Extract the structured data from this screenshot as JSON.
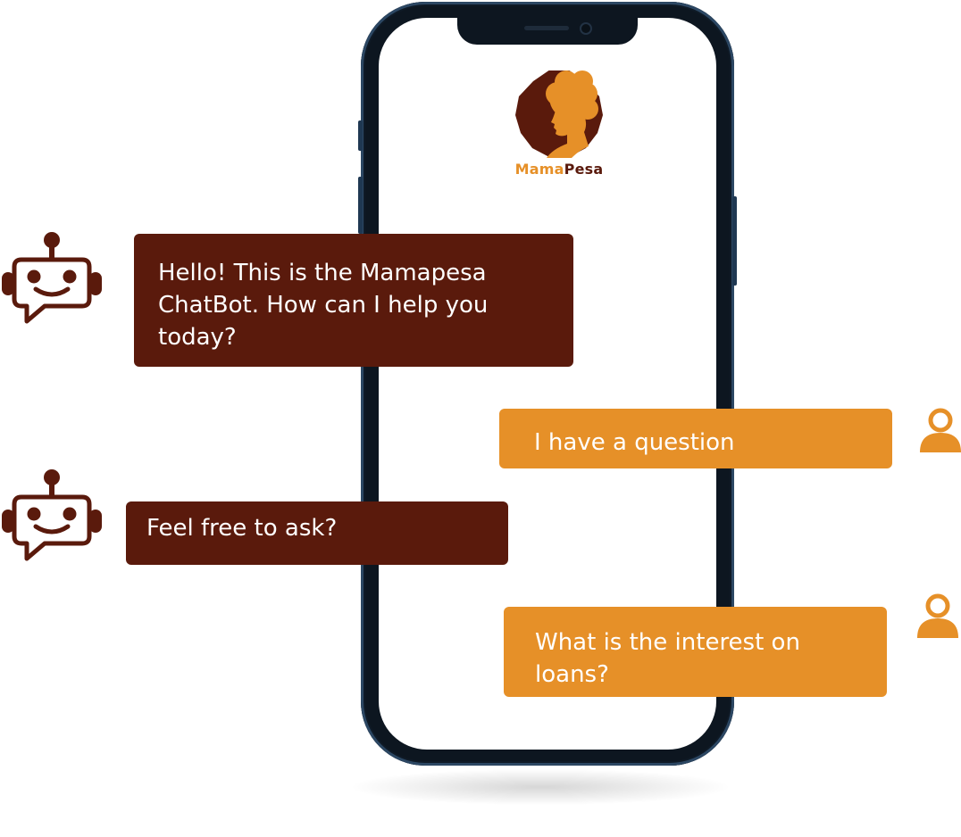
{
  "brand": {
    "name_part_1": "Mama",
    "name_part_2": "Pesa",
    "logo_icon": "woman-silhouette-logo",
    "colors": {
      "primary_dark": "#5a1a0c",
      "accent_orange": "#e69028"
    }
  },
  "messages": [
    {
      "sender": "bot",
      "icon": "robot-chat-icon",
      "text": "Hello!  This is the Mamapesa ChatBot. How can I help you today?"
    },
    {
      "sender": "user",
      "icon": "user-icon",
      "text": "I have a question"
    },
    {
      "sender": "bot",
      "icon": "robot-chat-icon",
      "text": "Feel free to ask?"
    },
    {
      "sender": "user",
      "icon": "user-icon",
      "text": "What is the interest on loans?"
    }
  ]
}
